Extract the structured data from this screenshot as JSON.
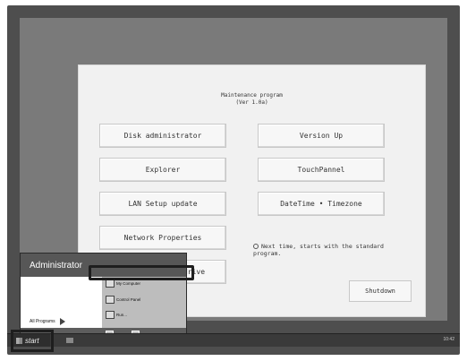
{
  "program": {
    "title_line1": "Maintenance program",
    "title_line2": "(Ver 1.0a)"
  },
  "buttons": {
    "disk_admin": "Disk administrator",
    "version_up": "Version Up",
    "explorer": "Explorer",
    "touch_panel": "TouchPannel",
    "lan_setup": "LAN Setup update",
    "datetime": "DateTime • Timezone",
    "network": "Network Properties",
    "drive": "drive",
    "shutdown": "Shutdown"
  },
  "note": {
    "text": "Next time, starts with the standard program."
  },
  "start_menu": {
    "user": "Administrator",
    "all_programs": "All Programs",
    "items": [
      {
        "label": "My Computer",
        "icon": "computer-icon"
      },
      {
        "label": "Control Panel",
        "icon": "control-panel-icon"
      },
      {
        "label": "Run...",
        "icon": "run-icon"
      }
    ],
    "log_off": "Log Off",
    "turn_off": "Turn Off Computer"
  },
  "taskbar": {
    "start_label": "start",
    "clock": "10:42"
  }
}
